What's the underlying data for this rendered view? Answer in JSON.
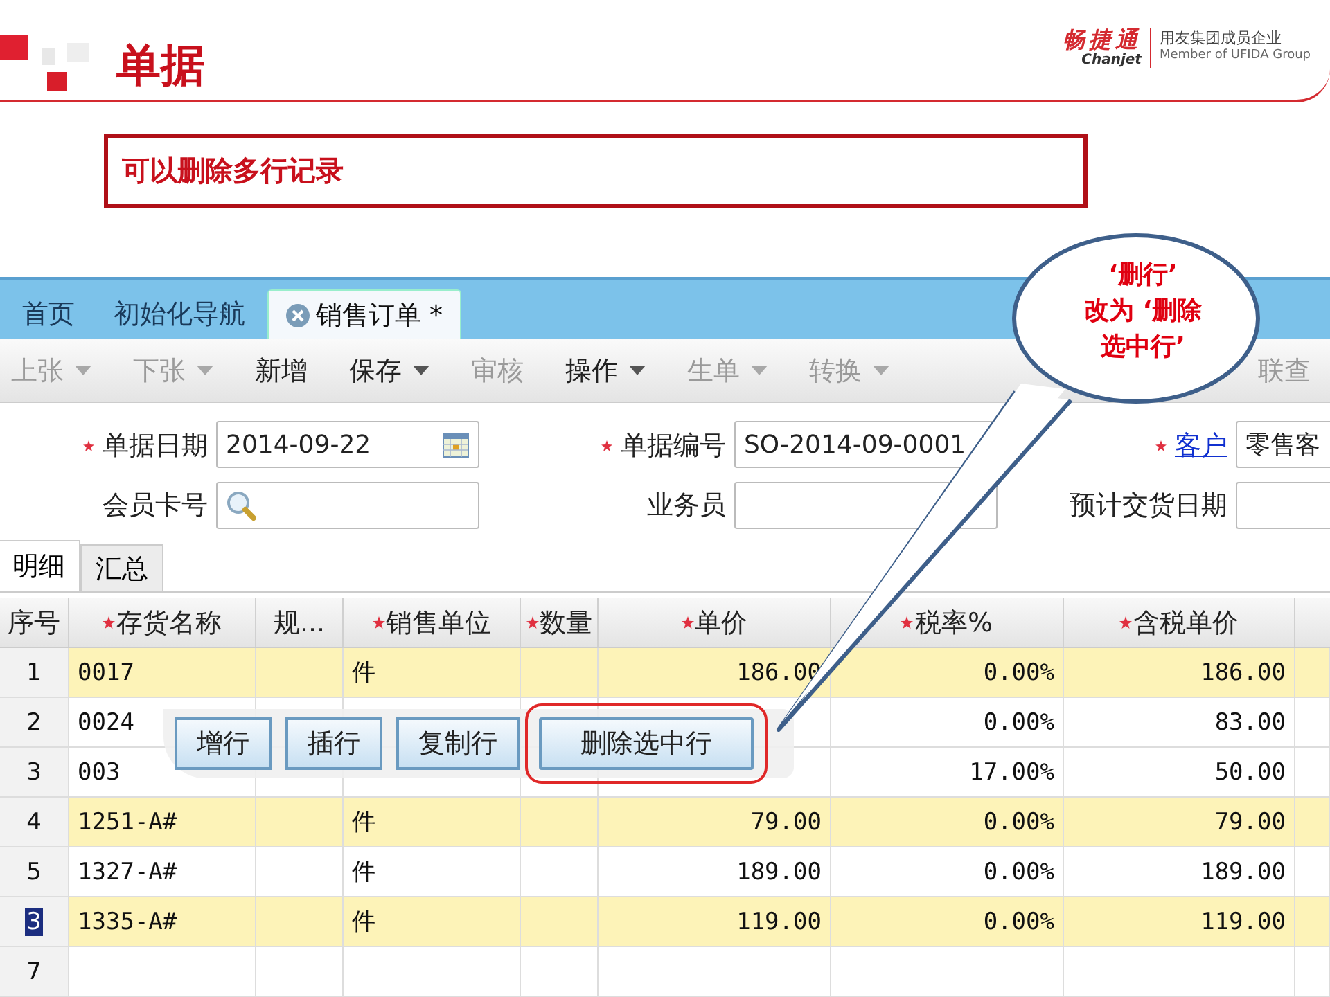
{
  "slide": {
    "title": "单据",
    "brand": "畅捷通",
    "brand_en": "Chanjet",
    "group": "用友集团成员企业",
    "group_en": "Member of UFIDA Group",
    "note": "可以删除多行记录"
  },
  "tabs": [
    {
      "label": "首页",
      "selected": false,
      "closable": false
    },
    {
      "label": "初始化导航",
      "selected": false,
      "closable": false
    },
    {
      "label": "销售订单 *",
      "selected": true,
      "closable": true
    }
  ],
  "toolbar": [
    {
      "label": "上张",
      "disabled": true,
      "dropdown": true
    },
    {
      "label": "下张",
      "disabled": true,
      "dropdown": true
    },
    {
      "label": "新增",
      "disabled": false,
      "dropdown": false
    },
    {
      "label": "保存",
      "disabled": false,
      "dropdown": true
    },
    {
      "label": "审核",
      "disabled": true,
      "dropdown": false
    },
    {
      "label": "操作",
      "disabled": false,
      "dropdown": true
    },
    {
      "label": "生单",
      "disabled": true,
      "dropdown": true
    },
    {
      "label": "转换",
      "disabled": true,
      "dropdown": true
    },
    {
      "label": "联查",
      "disabled": true,
      "dropdown": false
    }
  ],
  "form": [
    {
      "label": "单据日期",
      "required": true,
      "link": false,
      "value": "2014-09-22",
      "kind": "date"
    },
    {
      "label": "单据编号",
      "required": true,
      "link": false,
      "value": "SO-2014-09-0001",
      "kind": "text"
    },
    {
      "label": "客户",
      "required": true,
      "link": true,
      "value": "零售客",
      "kind": "text"
    },
    {
      "label": "会员卡号",
      "required": false,
      "link": false,
      "kind": "search"
    },
    {
      "label": "业务员",
      "required": false,
      "link": false,
      "kind": "text"
    },
    {
      "label": "预计交货日期",
      "required": false,
      "link": false,
      "kind": "text"
    }
  ],
  "subtabs": [
    {
      "label": "明细",
      "selected": true
    },
    {
      "label": "汇总",
      "selected": false
    }
  ],
  "table": {
    "columns": [
      {
        "label": "序号",
        "required": false
      },
      {
        "label": "存货名称",
        "required": true
      },
      {
        "label": "规...",
        "required": false
      },
      {
        "label": "销售单位",
        "required": true
      },
      {
        "label": "数量",
        "required": true
      },
      {
        "label": "单价",
        "required": true
      },
      {
        "label": "税率%",
        "required": true
      },
      {
        "label": "含税单价",
        "required": true
      }
    ],
    "rows": [
      {
        "cells": [
          "1",
          "0017",
          null,
          "件",
          null,
          "186.00",
          "0.00%",
          "186.00"
        ],
        "highlighted": true,
        "selected": false
      },
      {
        "cells": [
          "2",
          "0024",
          null,
          null,
          null,
          null,
          "0.00%",
          "83.00"
        ],
        "highlighted": false,
        "selected": false
      },
      {
        "cells": [
          "3",
          "003",
          null,
          null,
          null,
          null,
          "17.00%",
          "50.00"
        ],
        "highlighted": false,
        "selected": false
      },
      {
        "cells": [
          "4",
          "1251-A#",
          null,
          "件",
          null,
          "79.00",
          "0.00%",
          "79.00"
        ],
        "highlighted": true,
        "selected": false
      },
      {
        "cells": [
          "5",
          "1327-A#",
          null,
          "件",
          null,
          "189.00",
          "0.00%",
          "189.00"
        ],
        "highlighted": false,
        "selected": false
      },
      {
        "cells": [
          "3",
          "1335-A#",
          null,
          "件",
          null,
          "119.00",
          "0.00%",
          "119.00"
        ],
        "highlighted": true,
        "selected": true
      },
      {
        "cells": [
          "7"
        ],
        "highlighted": false,
        "selected": false
      }
    ]
  },
  "row_menu": [
    {
      "label": "增行",
      "circled": false
    },
    {
      "label": "插行",
      "circled": false
    },
    {
      "label": "复制行",
      "circled": false
    },
    {
      "label": "删除选中行",
      "circled": true
    }
  ],
  "callout": {
    "lines": [
      "‘删行’",
      "改为 ‘删除",
      "选中行’"
    ]
  }
}
